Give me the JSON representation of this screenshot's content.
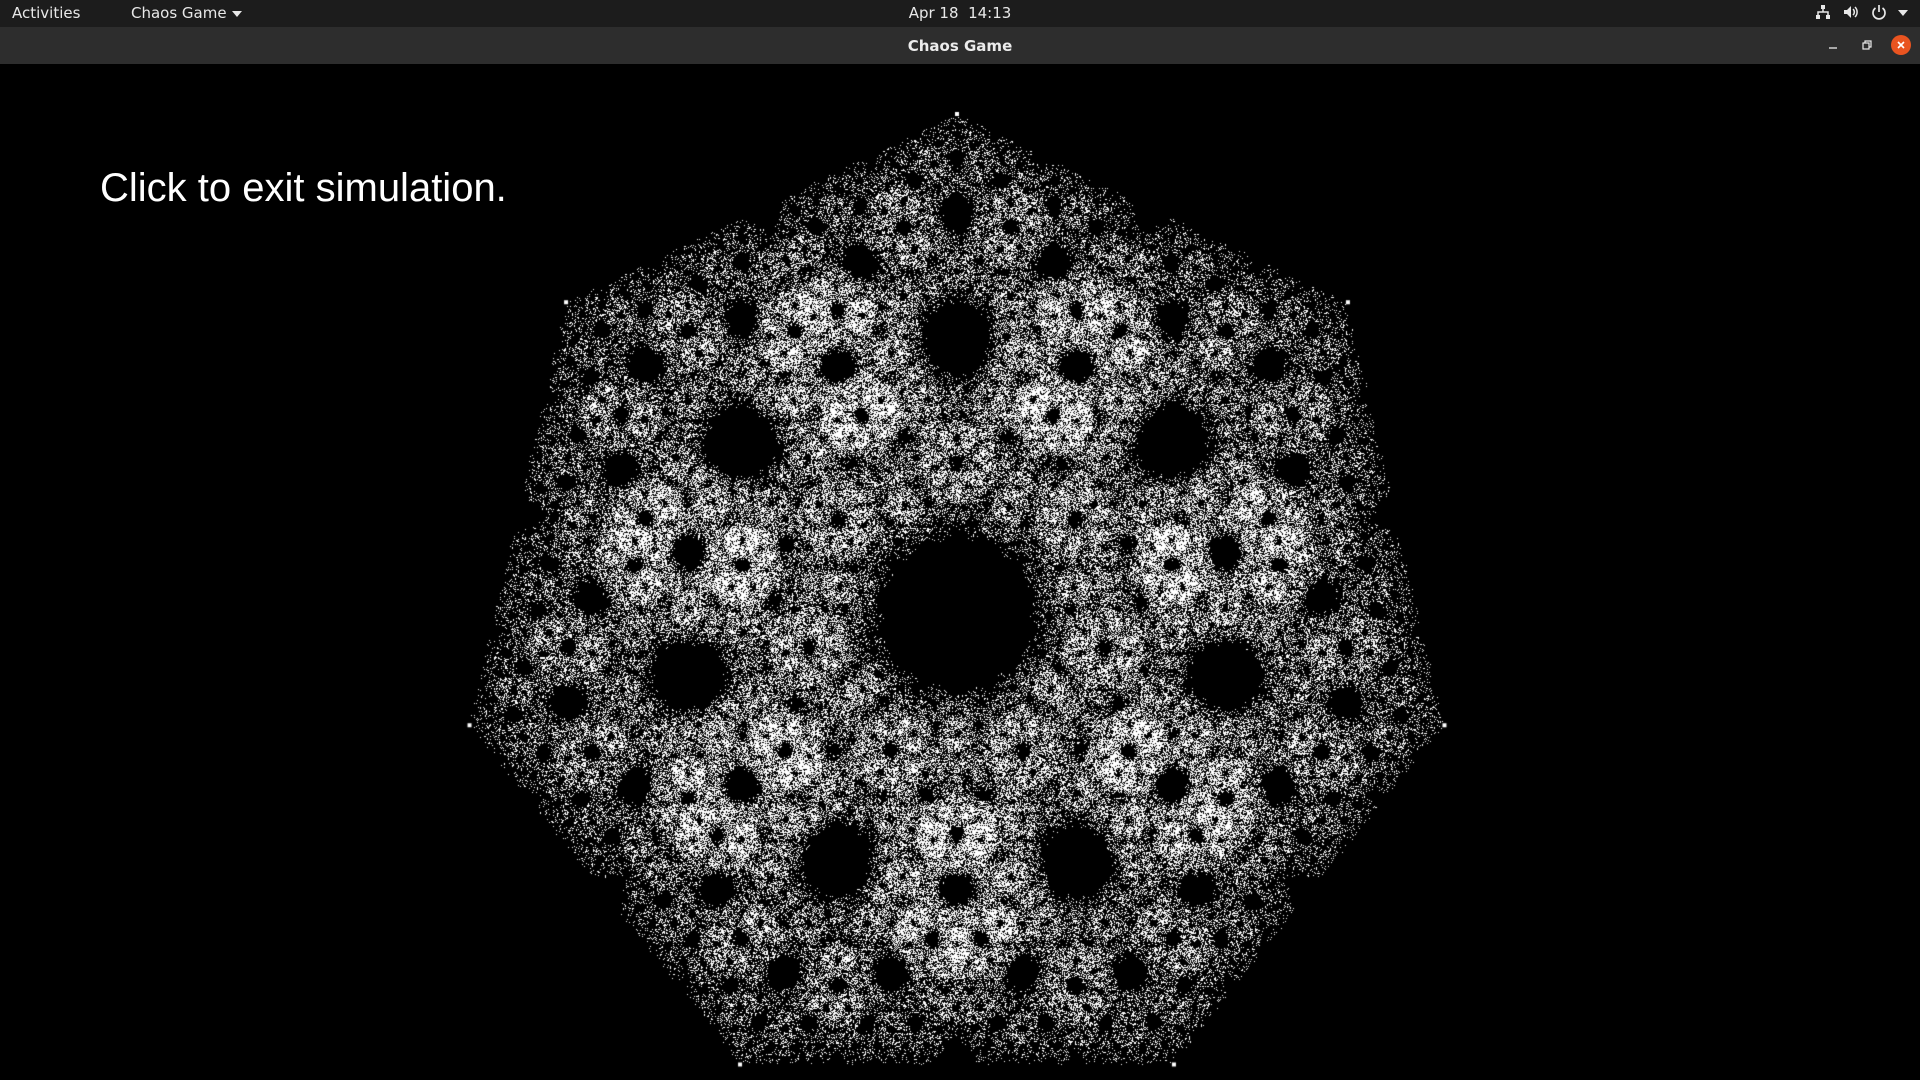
{
  "topbar": {
    "activities": "Activities",
    "app_menu": "Chaos Game",
    "date": "Apr 18",
    "time": "14:13",
    "tray_icons": [
      "network-icon",
      "volume-icon",
      "power-icon",
      "chevron-down-icon"
    ]
  },
  "window": {
    "title": "Chaos Game",
    "controls": [
      "minimize",
      "restore",
      "close"
    ],
    "close_color": "#e95420"
  },
  "simulation": {
    "message": "Click to exit simulation.",
    "background": "#000000",
    "point_color": "#ffffff",
    "vertices": 7
  }
}
